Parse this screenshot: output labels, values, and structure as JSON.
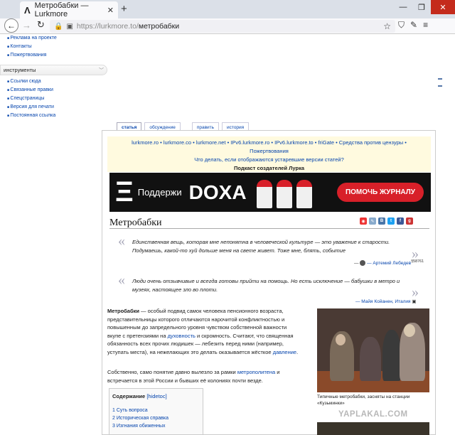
{
  "browser": {
    "tab_title": "Метробабки — Lurkmore",
    "tab_logo": "Λ",
    "tab_close": "✕",
    "new_tab": "+",
    "url_prefix": "https://lurkmore.to/",
    "url_path": "метробабки",
    "window_controls": [
      "—",
      "❐",
      "✕"
    ]
  },
  "sidebar": {
    "top_links": [
      "Реклама на проекте",
      "Контакты",
      "Пожертвования"
    ],
    "tools_header": "инструменты",
    "tools_links": [
      "Ссылки сюда",
      "Связанные правки",
      "Спецстраницы",
      "Версия для печати",
      "Постоянная ссылка"
    ]
  },
  "tabs": [
    "статья",
    "обсуждение",
    "править",
    "история"
  ],
  "infobox": {
    "line1": "lurkmore.ro • lurkmore.co • lurkmore.net • IPv6.lurkmore.ro • IPv6.lurkmore.to • friGate • Средства против цензуры •",
    "line2": "Пожертвования",
    "line3": "Что делать, если отображаются устаревшие версии статей?",
    "line4": "Подкаст создателей Лурка"
  },
  "banner": {
    "logo_mark": "Ξ",
    "text1": "Поддержи",
    "text2": "DOXA",
    "button": "ПОМОЧЬ ЖУРНАЛУ"
  },
  "article": {
    "title": "Метробабки",
    "quote1": "Единственная вещь, которая мне непонятна в человеческой культуре — это уважение к старости. Подумаешь, какой-то хуй дольше меня на свете живет. Тоже мне, блять, событие",
    "quote1_cite": "— Артемий Лебедев",
    "quote1_ref": "§58761",
    "quote2": "Люди очень отзывчивые и всегда готовы прийти на помощь. Но есть исключение — бабушки в метро и музеях, настоящее зло во плоти.",
    "quote2_cite": "— Майя Койанен, Италия",
    "para1_bold": "Метробабки",
    "para1_a": " — особый подвид самок человека пенсионного возраста, представительницы которого отличаются нарочитой конфликтностью и повышенным до запредельного уровня чувством собственной важности вкупе с претензиями на ",
    "para1_link1": "духовность",
    "para1_b": " и скромность. Считают, что священная обязанность всех прочих людишек — лебезить перед ними (например, уступать места), на нежелающих это делать оказывается жёсткое ",
    "para1_link2": "давление",
    "para1_c": ".",
    "para2_a": "Собственно, само понятие давно вылезло за рамки ",
    "para2_link": "метрополитена",
    "para2_b": " и встречается в этой России и бывших её колониях почти везде.",
    "caption": "Типичные метробабки, засняты на станции «Кузьминки»"
  },
  "toc": {
    "title": "Содержание",
    "hide": "[hidetoc]",
    "items": [
      "1 Суть вопроса",
      "2 Историческая справка",
      "3 Изгнания обиженных"
    ]
  },
  "watermark": "YAPLAKAL.COM"
}
